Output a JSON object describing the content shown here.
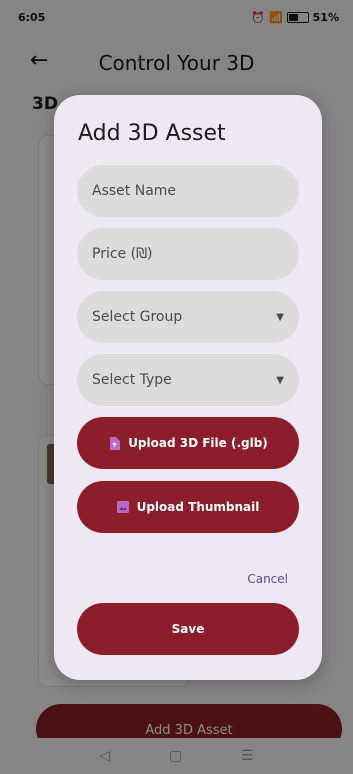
{
  "status_bar": {
    "time": "6:05",
    "battery": "51%"
  },
  "app_bar": {
    "title": "Control Your 3D"
  },
  "page": {
    "section_title": "3D",
    "bottom_button": "Add 3D Asset"
  },
  "dialog": {
    "title": "Add 3D Asset",
    "fields": {
      "asset_name": "Asset Name",
      "price": "Price (₪)",
      "group": "Select Group",
      "type": "Select Type"
    },
    "upload_file": "Upload 3D File (.glb)",
    "upload_thumbnail": "Upload Thumbnail",
    "cancel": "Cancel",
    "save": "Save"
  },
  "icons": [
    "back-arrow-icon",
    "file-upload-icon",
    "image-icon",
    "chevron-down-icon"
  ],
  "colors": {
    "primary": "#8b1e2a",
    "dialog_bg": "#eee8f3",
    "link": "#5b4a9b"
  }
}
